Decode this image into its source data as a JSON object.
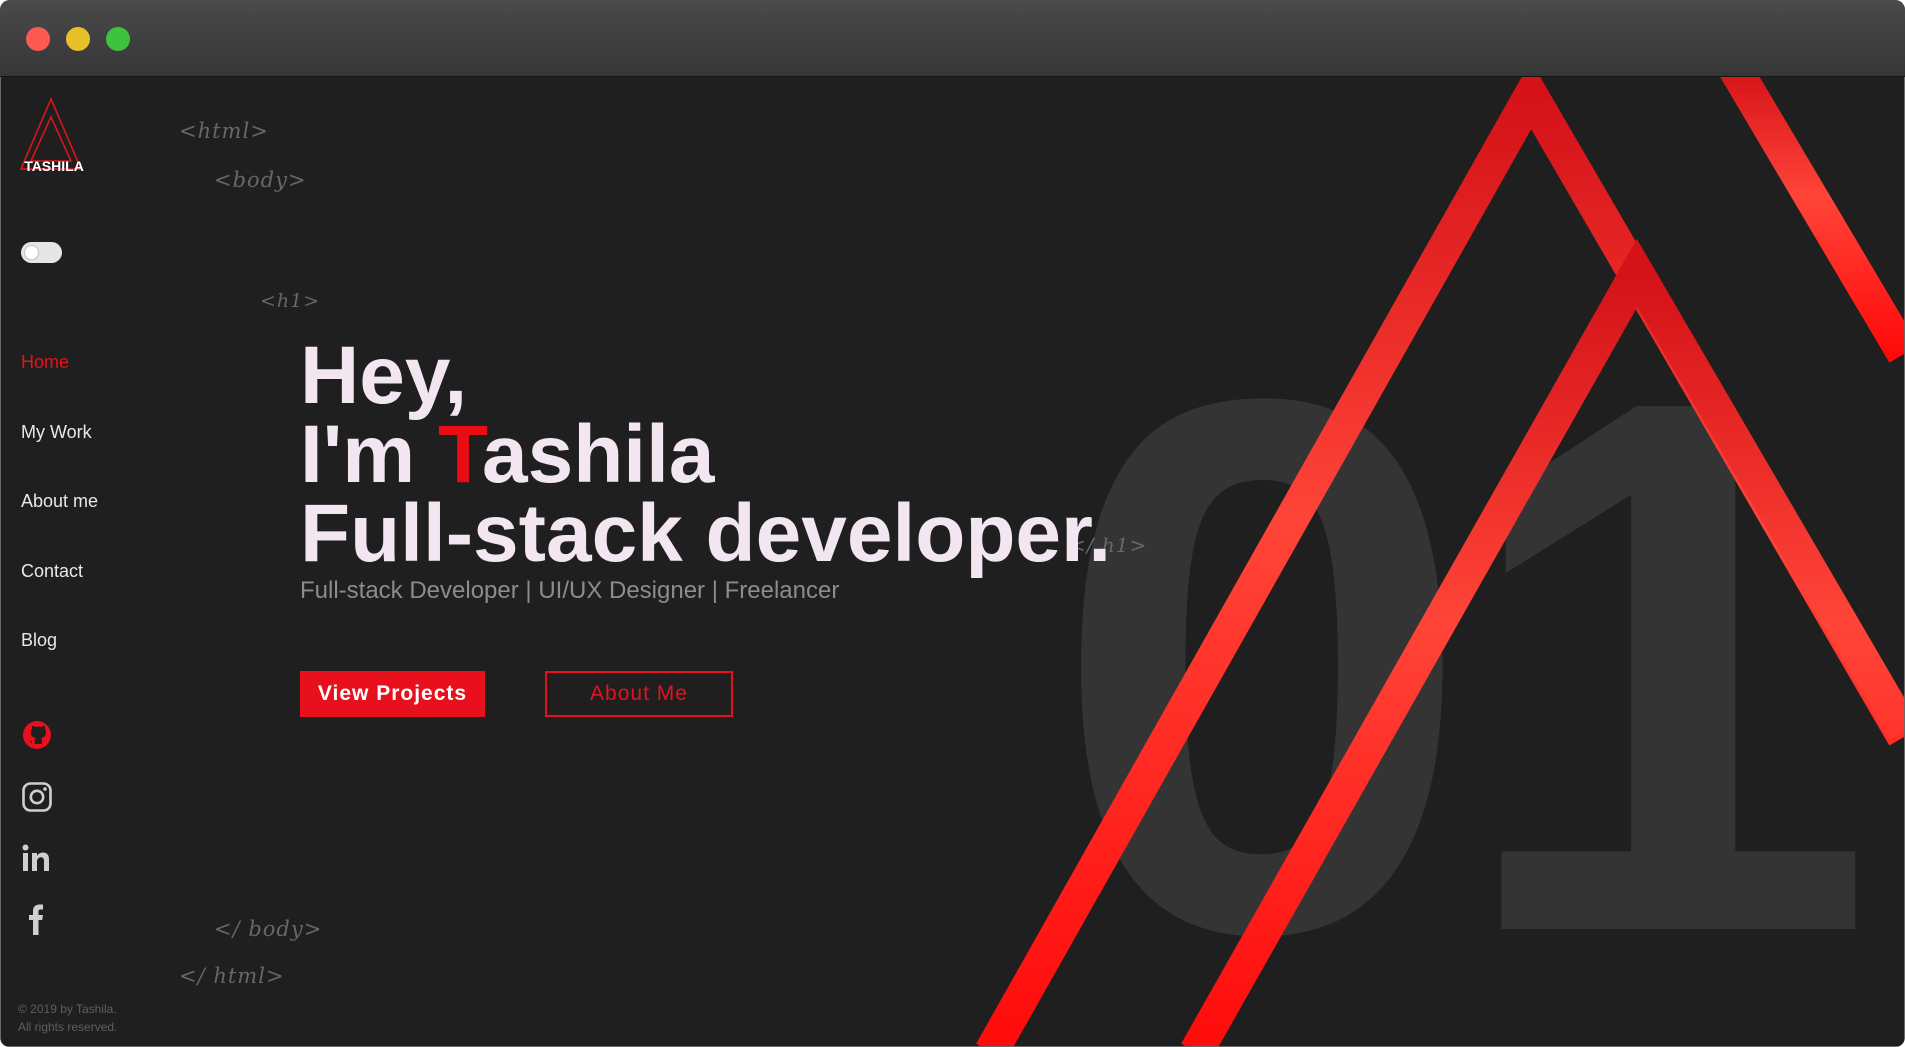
{
  "window": {
    "controls": [
      "close",
      "minimize",
      "zoom"
    ]
  },
  "brand": {
    "name": "TASHILA",
    "logo_icon": "triangle-logo-icon"
  },
  "theme_toggle": {
    "state": "off"
  },
  "nav": {
    "items": [
      {
        "label": "Home",
        "active": true
      },
      {
        "label": "My Work",
        "active": false
      },
      {
        "label": "About me",
        "active": false
      },
      {
        "label": "Contact",
        "active": false
      },
      {
        "label": "Blog",
        "active": false
      }
    ]
  },
  "social": [
    {
      "name": "github-icon"
    },
    {
      "name": "instagram-icon"
    },
    {
      "name": "linkedin-icon"
    },
    {
      "name": "facebook-icon"
    }
  ],
  "footer": {
    "line1": "© 2019 by Tashila.",
    "line2": "All rights reserved."
  },
  "code_tags": {
    "html_open": "<html>",
    "body_open": "<body>",
    "h1_open": "<h1>",
    "h1_close": "</ h1>",
    "body_close": "</ body>",
    "html_close": "</ html>"
  },
  "hero": {
    "line1": "Hey,",
    "line2_prefix": "I'm ",
    "line2_accent": "T",
    "line2_rest": "ashila",
    "line3": "Full-stack developer.",
    "subtitle": "Full-stack Developer | UI/UX Designer | Freelancer",
    "primary_button": "View Projects",
    "secondary_button": "About Me"
  },
  "background_number": "01",
  "colors": {
    "accent": "#e8101c",
    "background": "#1f1f1f",
    "text": "#f2e6f0",
    "muted": "#8c8c8c",
    "big_number": "#343434"
  }
}
